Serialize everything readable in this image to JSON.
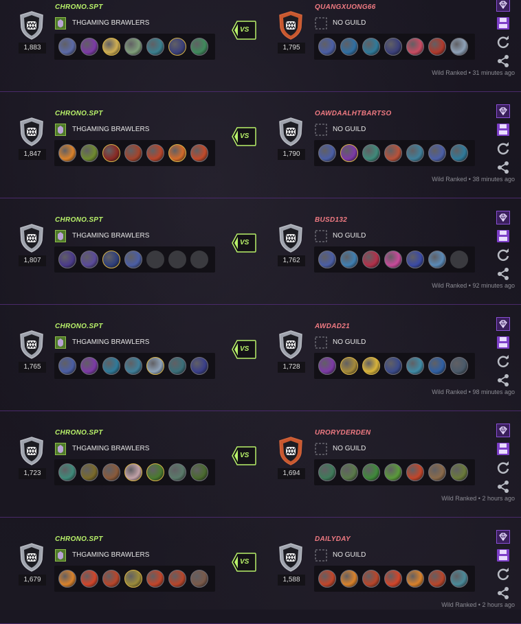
{
  "battles": [
    {
      "player": {
        "name": "CHRONO.SPT",
        "rating": "1,883",
        "guild": "THGAMING BRAWLERS"
      },
      "opponent": {
        "name": "QUANGXUONG66",
        "rating": "1,795",
        "guild": "NO GUILD",
        "shield": "orange"
      },
      "vs": "VS",
      "meta": "Wild Ranked • 31 minutes ago",
      "player_cards": [
        "#5b6aa8",
        "#7c3aa6",
        "#cfae53",
        "#7f9e7a",
        "#3a7f8f",
        "#3a3f7a",
        "#3f8a5c"
      ],
      "player_gold": [
        2,
        5
      ],
      "opp_cards": [
        "#4a5ea5",
        "#2f6fa3",
        "#2f7a9a",
        "#3a3f7a",
        "#c94b62",
        "#b0392c",
        "#8ea2b8"
      ],
      "opp_gold": []
    },
    {
      "player": {
        "name": "CHRONO.SPT",
        "rating": "1,847",
        "guild": "THGAMING BRAWLERS"
      },
      "opponent": {
        "name": "OAWDAALHTBARTSO",
        "rating": "1,790",
        "guild": "NO GUILD",
        "shield": "gray"
      },
      "vs": "VS",
      "meta": "Wild Ranked • 38 minutes ago",
      "player_cards": [
        "#d9822b",
        "#6f8a2f",
        "#8a2a24",
        "#a2442c",
        "#b8452a",
        "#d26a2a",
        "#c24a2a"
      ],
      "player_gold": [
        2,
        5
      ],
      "opp_cards": [
        "#4a5ea5",
        "#7c3aa6",
        "#3f8a7a",
        "#b8523a",
        "#3f7f9a",
        "#4b5fa7",
        "#2f7a9a"
      ],
      "opp_gold": [
        1
      ]
    },
    {
      "player": {
        "name": "CHRONO.SPT",
        "rating": "1,807",
        "guild": "THGAMING BRAWLERS"
      },
      "opponent": {
        "name": "BUSD132",
        "rating": "1,762",
        "guild": "NO GUILD",
        "shield": "gray"
      },
      "vs": "VS",
      "meta": "Wild Ranked • 92 minutes ago",
      "player_cards": [
        "#4a3a8a",
        "#5a4a9a",
        "#2f3f7a",
        "#4a5ea5",
        "empty",
        "empty",
        "empty"
      ],
      "player_gold": [
        2
      ],
      "opp_cards": [
        "#4a5ea5",
        "#3f7fb2",
        "#b2304a",
        "#c74a9a",
        "#3a4aa5",
        "#5a8ab8",
        "empty"
      ],
      "opp_gold": []
    },
    {
      "player": {
        "name": "CHRONO.SPT",
        "rating": "1,765",
        "guild": "THGAMING BRAWLERS"
      },
      "opponent": {
        "name": "AWDAD21",
        "rating": "1,728",
        "guild": "NO GUILD",
        "shield": "gray"
      },
      "vs": "VS",
      "meta": "Wild Ranked • 98 minutes ago",
      "player_cards": [
        "#4a5ea5",
        "#7c3aa6",
        "#2f7a9a",
        "#3f7f9a",
        "#8ea2b8",
        "#3a6f7a",
        "#3a3f8a"
      ],
      "player_gold": [
        4
      ],
      "opp_cards": [
        "#7c3aa6",
        "#a58a3a",
        "#d9b43a",
        "#3a4a8a",
        "#3f8aa5",
        "#2f5fa3",
        "#4a5a6a"
      ],
      "opp_gold": [
        1,
        2
      ]
    },
    {
      "player": {
        "name": "CHRONO.SPT",
        "rating": "1,723",
        "guild": "THGAMING BRAWLERS"
      },
      "opponent": {
        "name": "URORYDERDEN",
        "rating": "1,694",
        "guild": "NO GUILD",
        "shield": "orange"
      },
      "vs": "VS",
      "meta": "Wild Ranked • 2 hours ago",
      "player_cards": [
        "#3f8a7a",
        "#7a6a2a",
        "#8a5a3a",
        "#c2a2a8",
        "#4a7a2f",
        "#5a7a6a",
        "#4a6a2f"
      ],
      "player_gold": [
        3,
        4
      ],
      "opp_cards": [
        "#3f7a5a",
        "#5a7a4a",
        "#3f8a3a",
        "#5a9a3a",
        "#c2452a",
        "#8a6a4a",
        "#6a7a3a"
      ],
      "opp_gold": []
    },
    {
      "player": {
        "name": "CHRONO.SPT",
        "rating": "1,679",
        "guild": "THGAMING BRAWLERS"
      },
      "opponent": {
        "name": "DAILYDAY",
        "rating": "1,588",
        "guild": "NO GUILD",
        "shield": "gray"
      },
      "vs": "VS",
      "meta": "Wild Ranked • 2 hours ago",
      "player_cards": [
        "#d9822b",
        "#d2452a",
        "#b8452a",
        "#9a8a3a",
        "#c2452a",
        "#b8452a",
        "#7a5a4a"
      ],
      "player_gold": [
        3
      ],
      "opp_cards": [
        "#c2452a",
        "#d9822b",
        "#b8452a",
        "#d2452a",
        "#d9822b",
        "#b8452a",
        "#4a8a9a"
      ],
      "opp_gold": []
    }
  ],
  "colors": {
    "accent_green": "#b9f26a",
    "opponent_red": "#f07a82",
    "action_purple": "#8a4fd6",
    "separator": "#4a2a6b"
  }
}
